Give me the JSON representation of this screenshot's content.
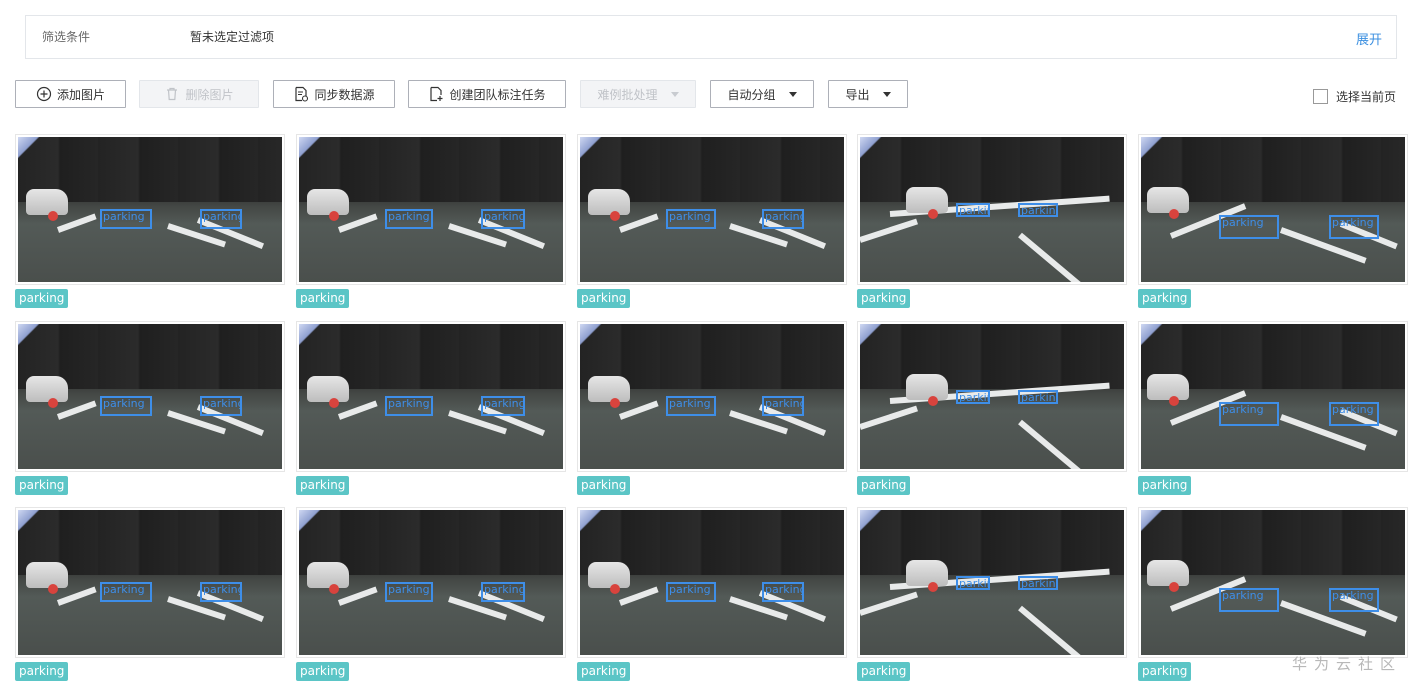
{
  "filter": {
    "label": "筛选条件",
    "value": "暂未选定过滤项",
    "expand": "展开"
  },
  "toolbar": {
    "add_images": "添加图片",
    "delete_images": "删除图片",
    "sync_datasource": "同步数据源",
    "create_team_task": "创建团队标注任务",
    "hard_case_batch": "难例批处理",
    "auto_group": "自动分组",
    "export": "导出",
    "select_page": "选择当前页"
  },
  "colors": {
    "accent_link": "#3b8fe0",
    "tag_bg": "#5bc5c6",
    "bbox": "#3e8ee8"
  },
  "images": [
    {
      "tag": "parking",
      "boxes": [
        "parking",
        "parking"
      ]
    },
    {
      "tag": "parking",
      "boxes": [
        "parking",
        "parking"
      ]
    },
    {
      "tag": "parking",
      "boxes": [
        "parking",
        "parking"
      ]
    },
    {
      "tag": "parking",
      "boxes": [
        "parking",
        "parking"
      ]
    },
    {
      "tag": "parking",
      "boxes": [
        "parking",
        "parking"
      ]
    },
    {
      "tag": "parking",
      "boxes": [
        "parking",
        "parking"
      ]
    },
    {
      "tag": "parking",
      "boxes": [
        "parking",
        "parking"
      ]
    },
    {
      "tag": "parking",
      "boxes": [
        "parking",
        "parking"
      ]
    },
    {
      "tag": "parking",
      "boxes": [
        "parking",
        "parking"
      ]
    },
    {
      "tag": "parking",
      "boxes": [
        "parking",
        "parking"
      ]
    },
    {
      "tag": "parking",
      "boxes": [
        "parking",
        "parking"
      ]
    },
    {
      "tag": "parking",
      "boxes": [
        "parking",
        "parking"
      ]
    },
    {
      "tag": "parking",
      "boxes": [
        "parking",
        "parking"
      ]
    },
    {
      "tag": "parking",
      "boxes": [
        "parking",
        "parking"
      ]
    },
    {
      "tag": "parking",
      "boxes": [
        "parking",
        "parking"
      ]
    }
  ],
  "watermark": "华为云社区"
}
